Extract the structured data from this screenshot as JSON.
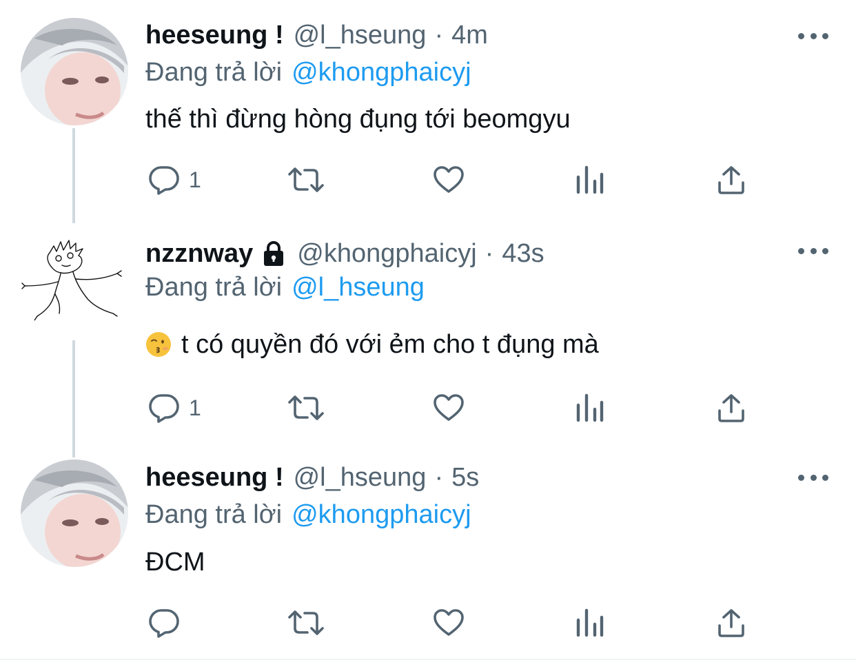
{
  "tweets": [
    {
      "name": "heeseung !",
      "handle": "@l_hseung",
      "separator": "·",
      "time": "4m",
      "replying_prefix": "Đang trả lời",
      "replying_to": "@khongphaicyj",
      "text": "thế thì đừng hòng đụng tới beomgyu",
      "reply_count": "1",
      "avatar": "photo-avatar"
    },
    {
      "name": "nzznway",
      "locked": true,
      "handle": "@khongphaicyj",
      "separator": "·",
      "time": "43s",
      "replying_prefix": "Đang trả lời",
      "replying_to": "@l_hseung",
      "emoji": "kissing-face-emoji",
      "text": "t có quyền đó với ẻm cho t đụng mà",
      "reply_count": "1",
      "avatar": "doodle-avatar"
    },
    {
      "name": "heeseung !",
      "handle": "@l_hseung",
      "separator": "·",
      "time": "5s",
      "replying_prefix": "Đang trả lời",
      "replying_to": "@khongphaicyj",
      "text": "ĐCM",
      "reply_count": "",
      "avatar": "photo-avatar"
    }
  ],
  "icons": {
    "reply": "reply-icon",
    "retweet": "retweet-icon",
    "like": "heart-icon",
    "analytics": "analytics-icon",
    "share": "share-icon",
    "more": "more-icon",
    "lock": "lock-icon"
  },
  "colors": {
    "text": "#0f1419",
    "secondary": "#536471",
    "link": "#1d9bf0",
    "thread_line": "#cfd9de"
  }
}
